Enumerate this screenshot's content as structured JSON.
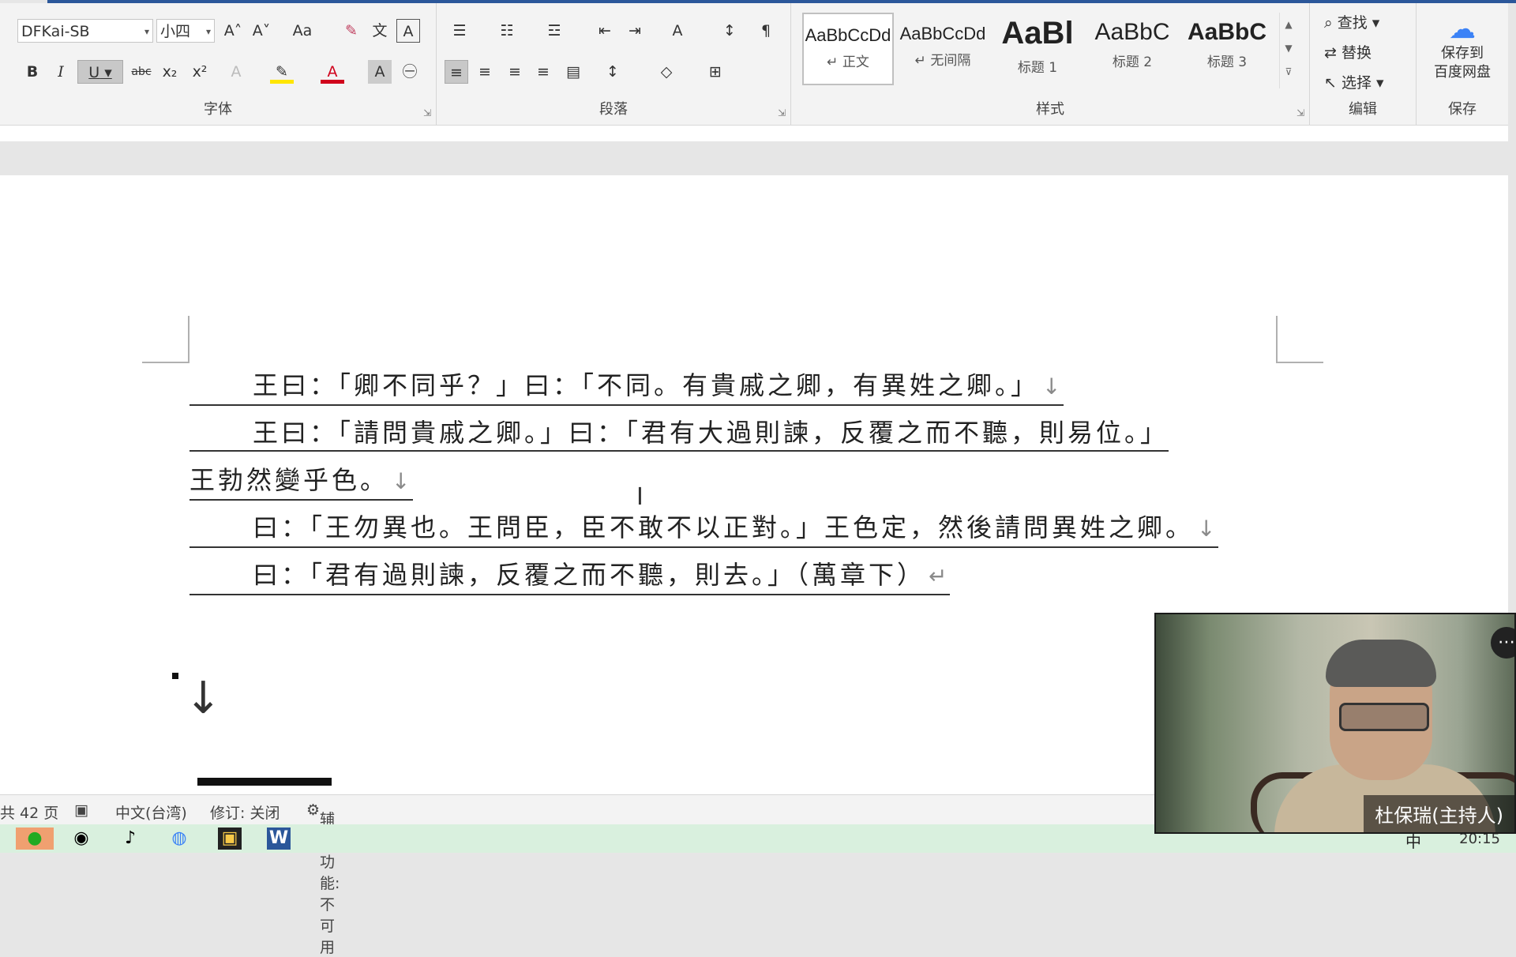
{
  "ribbon": {
    "font": {
      "family": "DFKai-SB",
      "size": "小四",
      "grow_icon": "A˄",
      "shrink_icon": "A˅",
      "case_label": "Aa",
      "bold": "B",
      "italic": "I",
      "underline": "U",
      "strike": "abc",
      "sub": "x₂",
      "sup": "x²",
      "label": "字体"
    },
    "paragraph": {
      "label": "段落"
    },
    "styles": {
      "label": "样式",
      "items": [
        {
          "sample": "AaBbCcDd",
          "name": "↵ 正文"
        },
        {
          "sample": "AaBbCcDd",
          "name": "↵ 无间隔"
        },
        {
          "sample": "AaBl",
          "name": "标题 1"
        },
        {
          "sample": "AaBbC",
          "name": "标题 2"
        },
        {
          "sample": "AaBbC",
          "name": "标题 3"
        }
      ]
    },
    "edit": {
      "label": "编辑",
      "find": "查找",
      "replace": "替换",
      "select": "选择"
    },
    "save": {
      "label": "保存",
      "button": "保存到\n百度网盘"
    },
    "accent_color": "#2b579a",
    "font_color": "#d0021b",
    "highlight_color": "#ffe600"
  },
  "document": {
    "lines": [
      {
        "indent": true,
        "text": "王曰：「卿不同乎？」曰：「不同。有貴戚之卿，有異姓之卿。」",
        "mark": "↓"
      },
      {
        "indent": true,
        "text": "王曰：「請問貴戚之卿。」曰：「君有大過則諫，反覆之而不聽，則易位。」",
        "mark": ""
      },
      {
        "indent": false,
        "text": "王勃然變乎色。",
        "mark": "↓"
      },
      {
        "indent": true,
        "text": "曰：「王勿異也。王問臣，臣不敢不以正對。」王色定，然後請問異姓之卿。",
        "mark": "↓"
      },
      {
        "indent": true,
        "text": "曰：「君有過則諫，反覆之而不聽，則去。」（萬章下）",
        "mark": "↵"
      }
    ],
    "empty_para_mark": "↓"
  },
  "status": {
    "pages": "共 42 页",
    "language": "中文(台湾)",
    "track_changes": "修订: 关闭",
    "accessibility": "辅助功能: 不可用"
  },
  "video": {
    "name": "杜保瑞(主持人)"
  },
  "taskbar": {
    "ime": "中",
    "time": "20:15"
  }
}
